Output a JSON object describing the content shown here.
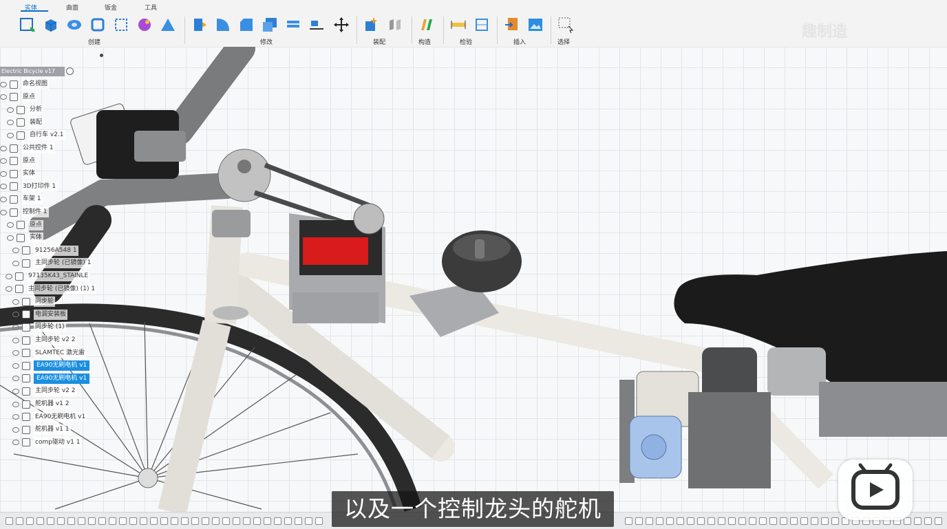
{
  "toolbar": {
    "tabs": [
      "实体",
      "曲面",
      "钣金",
      "工具"
    ],
    "groups": [
      "创建",
      "修改",
      "装配",
      "构造",
      "检验",
      "插入",
      "选择"
    ],
    "watermark": "趣制造"
  },
  "browser": {
    "title": "Electric Bicycle v17",
    "items": [
      {
        "label": "命名视图",
        "selected": false
      },
      {
        "label": "原点",
        "selected": false
      },
      {
        "label": "分析",
        "selected": false
      },
      {
        "label": "装配",
        "selected": false
      },
      {
        "label": "自行车 v2.1",
        "selected": false
      },
      {
        "label": "公共控件 1",
        "selected": false
      },
      {
        "label": "原点",
        "selected": false
      },
      {
        "label": "实体",
        "selected": false
      },
      {
        "label": "3D打印件 1",
        "selected": false
      },
      {
        "label": "车架 1",
        "selected": false
      },
      {
        "label": "控制件 1",
        "selected": false
      },
      {
        "label": "原点",
        "selected": false
      },
      {
        "label": "实体",
        "selected": false
      },
      {
        "label": "91256A548 1",
        "selected": false
      },
      {
        "label": "主同步轮 (已镜像) 1",
        "selected": false
      },
      {
        "label": "97135K43_STAINLE",
        "selected": false
      },
      {
        "label": "主同步轮 (已镜像) (1) 1",
        "selected": false
      },
      {
        "label": "同步轮",
        "selected": false
      },
      {
        "label": "电调安装板",
        "selected": false
      },
      {
        "label": "同步轮 (1)",
        "selected": false
      },
      {
        "label": "主同步轮 v2 2",
        "selected": false
      },
      {
        "label": "SLAMTEC 激光雷",
        "selected": false
      },
      {
        "label": "EA90无刷电机 v1",
        "selected": true
      },
      {
        "label": "EA90无刷电机 v1",
        "selected": true
      },
      {
        "label": "主同步轮 v2 2",
        "selected": false
      },
      {
        "label": "舵机器 v1 2",
        "selected": false
      },
      {
        "label": "EA90无刷电机 v1",
        "selected": false
      },
      {
        "label": "舵机器 v1 1",
        "selected": false
      },
      {
        "label": "comp驱动 v1 1",
        "selected": false
      }
    ]
  },
  "subtitle": "以及一个控制龙头的舵机",
  "colors": {
    "accent": "#0a6ec8",
    "selection": "#1a8fe0",
    "servo_red": "#d81b1b",
    "frame_white": "#ebe9e2"
  }
}
